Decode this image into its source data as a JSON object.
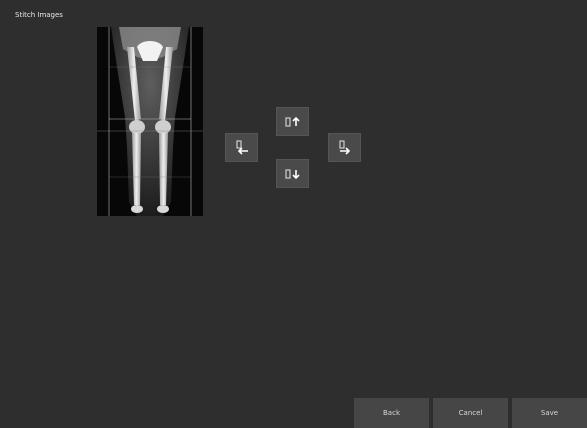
{
  "window": {
    "title": "Stitch Images"
  },
  "image": {
    "description_icon": "leg-xray-image"
  },
  "nudge": {
    "up_icon": "move-up-icon",
    "down_icon": "move-down-icon",
    "left_icon": "move-left-icon",
    "right_icon": "move-right-icon"
  },
  "footer": {
    "back_label": "Back",
    "cancel_label": "Cancel",
    "save_label": "Save"
  },
  "colors": {
    "background": "#2e2e2e",
    "button": "#464646",
    "nudge_button": "#4a4a4a",
    "text": "#e8e8e8"
  }
}
